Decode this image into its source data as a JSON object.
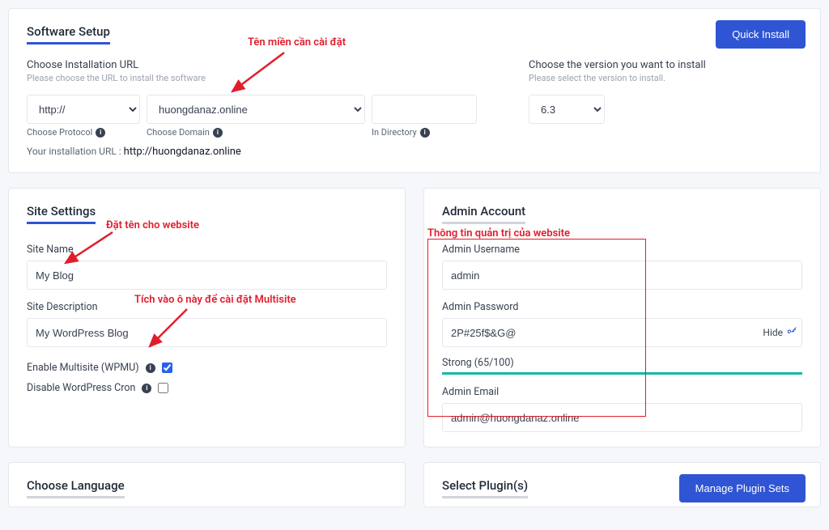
{
  "softwareSetup": {
    "title": "Software Setup",
    "quickInstall": "Quick Install",
    "chooseUrlLabel": "Choose Installation URL",
    "chooseUrlSub": "Please choose the URL to install the software",
    "protocolLabel": "Choose Protocol",
    "protocolValue": "http://",
    "domainLabel": "Choose Domain",
    "domainValue": "huongdanaz.online",
    "directoryLabel": "In Directory",
    "directoryValue": "",
    "urlLinePrefix": "Your installation URL : ",
    "urlLineValue": "http://huongdanaz.online",
    "chooseVersionLabel": "Choose the version you want to install",
    "chooseVersionSub": "Please select the version to install.",
    "versionValue": "6.3"
  },
  "siteSettings": {
    "title": "Site Settings",
    "siteNameLabel": "Site Name",
    "siteNameValue": "My Blog",
    "siteDescLabel": "Site Description",
    "siteDescValue": "My WordPress Blog",
    "enableMultisite": "Enable Multisite (WPMU)",
    "disableCron": "Disable WordPress Cron",
    "multisiteChecked": true,
    "cronChecked": false
  },
  "adminAccount": {
    "title": "Admin Account",
    "usernameLabel": "Admin Username",
    "usernameValue": "admin",
    "passwordLabel": "Admin Password",
    "passwordValue": "2P#25f$&G@",
    "hide": "Hide",
    "strength": "Strong (65/100)",
    "emailLabel": "Admin Email",
    "emailValue": "admin@huongdanaz.online"
  },
  "chooseLanguage": {
    "title": "Choose Language"
  },
  "selectPlugins": {
    "title": "Select Plugin(s)",
    "managePluginSets": "Manage Plugin Sets"
  },
  "annotations": {
    "domain": "Tên miền cần cài đặt",
    "siteName": "Đặt tên cho website",
    "multisite": "Tích vào ô này để cài đặt Multisite",
    "admin": "Thông tin quản trị của website"
  }
}
